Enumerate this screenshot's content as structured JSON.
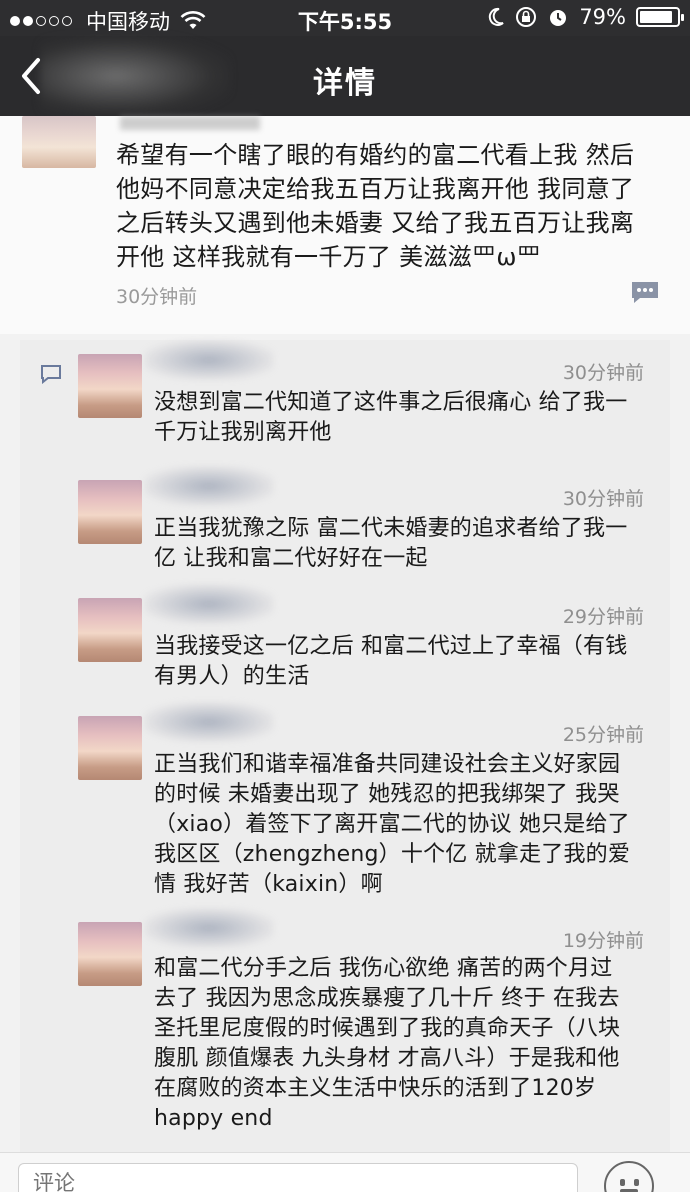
{
  "status_bar": {
    "carrier": "中国移动",
    "time": "下午5:55",
    "battery": "79%",
    "battery_level": 0.79,
    "signal_bars_on": 2,
    "signal_bars_total": 5
  },
  "nav": {
    "title": "详情",
    "back_icon": "chevron-left-icon"
  },
  "main_post": {
    "text": "希望有一个瞎了眼的有婚约的富二代看上我 然后他妈不同意决定给我五百万让我离开他 我同意了之后转头又遇到他未婚妻 又给了我五百万让我离开他 这样我就有一千万了 美滋滋罒ω罒",
    "time": "30分钟前"
  },
  "replies": [
    {
      "time": "30分钟前",
      "text": "没想到富二代知道了这件事之后很痛心 给了我一千万让我别离开他"
    },
    {
      "time": "30分钟前",
      "text": "正当我犹豫之际 富二代未婚妻的追求者给了我一亿 让我和富二代好好在一起"
    },
    {
      "time": "29分钟前",
      "text": "当我接受这一亿之后 和富二代过上了幸福（有钱有男人）的生活"
    },
    {
      "time": "25分钟前",
      "text": "正当我们和谐幸福准备共同建设社会主义好家园的时候 未婚妻出现了 她残忍的把我绑架了 我哭（xiao）着签下了离开富二代的协议 她只是给了我区区（zhengzheng）十个亿 就拿走了我的爱情 我好苦（kaixin）啊"
    },
    {
      "time": "19分钟前",
      "text": "和富二代分手之后 我伤心欲绝 痛苦的两个月过去了 我因为思念成疾暴瘦了几十斤 终于 在我去圣托里尼度假的时候遇到了我的真命天子（八块腹肌 颜值爆表 九头身材 才高八斗）于是我和他在腐败的资本主义生活中快乐的活到了120岁 happy end"
    }
  ],
  "comment_box": {
    "placeholder": "评论"
  },
  "colors": {
    "nav_bg": "#2b2b2d",
    "replies_bg": "#ededed",
    "time_gray": "#9a9a9a"
  }
}
